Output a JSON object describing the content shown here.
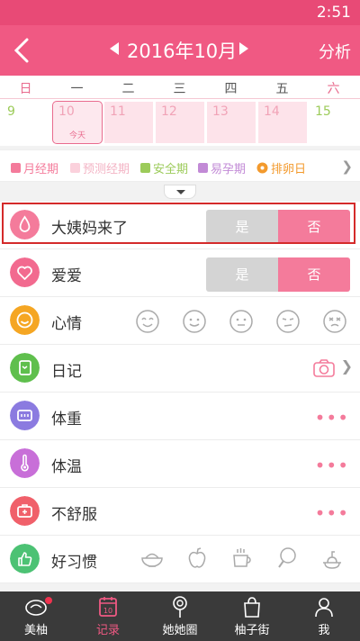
{
  "status": {
    "time": "2:51"
  },
  "header": {
    "title": "2016年10月",
    "analysis": "分析"
  },
  "weekdays": [
    "日",
    "一",
    "二",
    "三",
    "四",
    "五",
    "六"
  ],
  "days": [
    {
      "num": "9",
      "type": "green-white"
    },
    {
      "num": "10",
      "type": "today",
      "today_label": "今天"
    },
    {
      "num": "11",
      "type": "pink"
    },
    {
      "num": "12",
      "type": "pink"
    },
    {
      "num": "13",
      "type": "pink"
    },
    {
      "num": "14",
      "type": "pink"
    },
    {
      "num": "15",
      "type": "green-white"
    }
  ],
  "legend": {
    "items": [
      {
        "label": "月经期",
        "color": "#f47b9b"
      },
      {
        "label": "预测经期",
        "color": "#fbd1dc"
      },
      {
        "label": "安全期",
        "color": "#9ccb5a"
      },
      {
        "label": "易孕期",
        "color": "#c28ad6"
      },
      {
        "label": "排卵日",
        "color": "#f39a2d"
      }
    ]
  },
  "rows": {
    "period": {
      "label": "大姨妈来了",
      "yes": "是",
      "no": "否"
    },
    "love": {
      "label": "爱爱",
      "yes": "是",
      "no": "否"
    },
    "mood": {
      "label": "心情"
    },
    "diary": {
      "label": "日记"
    },
    "weight": {
      "label": "体重",
      "more": "•••"
    },
    "temperature": {
      "label": "体温",
      "more": "•••"
    },
    "discomfort": {
      "label": "不舒服",
      "more": "•••"
    },
    "habits": {
      "label": "好习惯"
    }
  },
  "colors": {
    "brand": "#f05983",
    "period_icon": "#f47b9b",
    "love_icon": "#f26a8f",
    "mood_icon": "#f5a623",
    "diary_icon": "#5fbf4d",
    "weight_icon": "#8b7be0",
    "temperature_icon": "#c86fd8",
    "discomfort_icon": "#f0606a",
    "habits_icon": "#4cc274"
  },
  "nav": {
    "items": [
      {
        "label": "美柚",
        "icon": "bowl-icon"
      },
      {
        "label": "记录",
        "icon": "calendar-icon"
      },
      {
        "label": "她她圈",
        "icon": "lollipop-icon"
      },
      {
        "label": "柚子街",
        "icon": "bag-icon"
      },
      {
        "label": "我",
        "icon": "profile-icon"
      }
    ]
  }
}
